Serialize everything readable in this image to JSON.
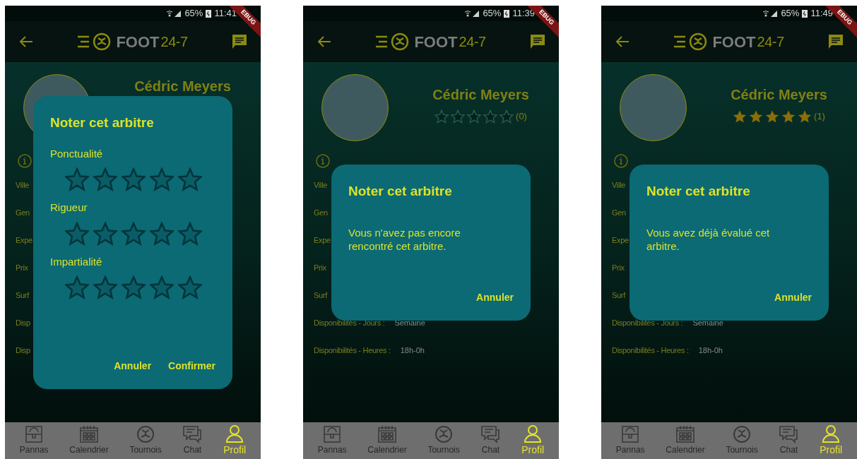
{
  "screens": [
    {
      "status_bar": {
        "battery": "65%",
        "time": "11:41"
      },
      "debug_banner": "EBUG",
      "app_bar": {
        "logo_word": "FOOT",
        "logo_number": "24-7"
      },
      "profile": {
        "name": "Cédric Meyers"
      },
      "info_rows": [
        {
          "label": "Ville"
        },
        {
          "label": "Gen"
        },
        {
          "label": "Expe"
        },
        {
          "label": "Prix"
        },
        {
          "label": "Surf"
        },
        {
          "label": "Disp"
        },
        {
          "label": "Disp"
        }
      ],
      "dialog": {
        "kind": "rating",
        "title": "Noter cet arbitre",
        "criteria": [
          {
            "label": "Ponctualité",
            "stars": 0
          },
          {
            "label": "Rigueur",
            "stars": 0
          },
          {
            "label": "Impartialité",
            "stars": 0
          }
        ],
        "actions": [
          "Annuler",
          "Confirmer"
        ]
      },
      "nav": [
        {
          "label": "Pannas",
          "selected": false
        },
        {
          "label": "Calendrier",
          "selected": false
        },
        {
          "label": "Tournois",
          "selected": false
        },
        {
          "label": "Chat",
          "selected": false
        },
        {
          "label": "Profil",
          "selected": true
        }
      ]
    },
    {
      "status_bar": {
        "battery": "65%",
        "time": "11:39"
      },
      "debug_banner": "EBUG",
      "app_bar": {
        "logo_word": "FOOT",
        "logo_number": "24-7"
      },
      "profile": {
        "name": "Cédric Meyers",
        "stars": 0,
        "rating_count": "(0)"
      },
      "info_rows": [
        {
          "label": "Ville"
        },
        {
          "label": "Gen"
        },
        {
          "label": "Expe"
        },
        {
          "label": "Prix"
        },
        {
          "label": "Surf"
        },
        {
          "label": "Disponibilités - Jours :",
          "value": "Semaine"
        },
        {
          "label": "Disponibilités - Heures :",
          "value": "18h-0h"
        }
      ],
      "dialog": {
        "kind": "message",
        "title": "Noter cet arbitre",
        "message": "Vous n'avez pas encore rencontré cet arbitre.",
        "actions": [
          "Annuler"
        ]
      },
      "nav": [
        {
          "label": "Pannas",
          "selected": false
        },
        {
          "label": "Calendrier",
          "selected": false
        },
        {
          "label": "Tournois",
          "selected": false
        },
        {
          "label": "Chat",
          "selected": false
        },
        {
          "label": "Profil",
          "selected": true
        }
      ]
    },
    {
      "status_bar": {
        "battery": "65%",
        "time": "11:49"
      },
      "debug_banner": "EBUG",
      "app_bar": {
        "logo_word": "FOOT",
        "logo_number": "24-7"
      },
      "profile": {
        "name": "Cédric Meyers",
        "stars": 5,
        "rating_count": "(1)"
      },
      "info_rows": [
        {
          "label": "Ville"
        },
        {
          "label": "Gen"
        },
        {
          "label": "Expe"
        },
        {
          "label": "Prix"
        },
        {
          "label": "Surf"
        },
        {
          "label": "Disponibilités - Jours :",
          "value": "Semaine"
        },
        {
          "label": "Disponibilités - Heures :",
          "value": "18h-0h"
        }
      ],
      "dialog": {
        "kind": "message",
        "title": "Noter cet arbitre",
        "message": "Vous avez déjà évalué cet arbitre.",
        "actions": [
          "Annuler"
        ]
      },
      "nav": [
        {
          "label": "Pannas",
          "selected": false
        },
        {
          "label": "Calendrier",
          "selected": false
        },
        {
          "label": "Tournois",
          "selected": false
        },
        {
          "label": "Chat",
          "selected": false
        },
        {
          "label": "Profil",
          "selected": true
        }
      ]
    }
  ]
}
